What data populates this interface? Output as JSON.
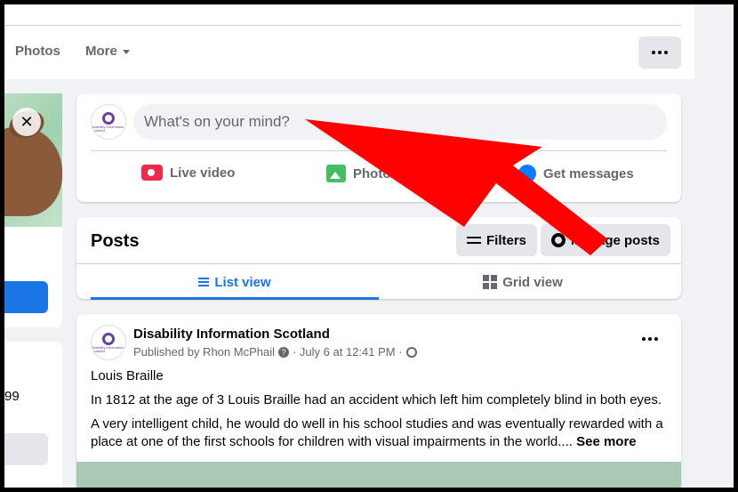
{
  "topbar": {
    "tabs": [
      "Photos",
      "More"
    ]
  },
  "left_column": {
    "partial_number": "99"
  },
  "composer": {
    "placeholder": "What's on your mind?",
    "avatar_text": "disability information scotland",
    "actions": {
      "live": "Live video",
      "photo": "Photo/",
      "messages": "Get messages"
    }
  },
  "posts_panel": {
    "title": "Posts",
    "filters_label": "Filters",
    "manage_label": "Manage posts",
    "views": [
      "List view",
      "Grid view"
    ],
    "active_view": "List view"
  },
  "post": {
    "author": "Disability Information Scotland",
    "published_by": "Published by Rhon McPhail",
    "date": "· July 6 at 12:41 PM ·",
    "title": "Louis Braille",
    "paragraph1": "In 1812 at the age of 3 Louis Braille had an accident which left him completely blind in both eyes.",
    "paragraph2": "A very intelligent child, he would do well in his school studies and was eventually rewarded with a place at one of the first schools for children with visual impairments in the world....",
    "see_more": "See more"
  },
  "annotation": {
    "arrow_color": "#ff0000"
  }
}
